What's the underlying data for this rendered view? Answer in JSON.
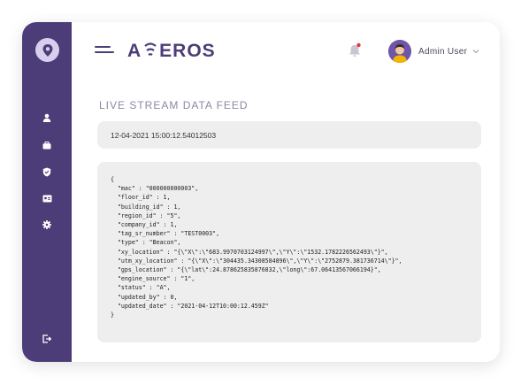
{
  "colors": {
    "sidebar": "#4c3d78",
    "accent": "#4c3d78",
    "panel": "#eeeeee",
    "notification_dot": "#e53935"
  },
  "sidebar": {
    "logo_icon": "location-pin-icon",
    "items": [
      {
        "name": "user",
        "icon": "user-icon"
      },
      {
        "name": "briefcase",
        "icon": "briefcase-icon"
      },
      {
        "name": "shield",
        "icon": "shield-icon"
      },
      {
        "name": "id-card",
        "icon": "id-card-icon"
      },
      {
        "name": "settings",
        "icon": "gear-icon"
      }
    ],
    "logout_icon": "logout-icon"
  },
  "header": {
    "brand": {
      "a": "A",
      "rest": "EROS"
    },
    "notification_icon": "bell-icon",
    "user": {
      "name": "Admin User",
      "avatar": "avatar-icon"
    }
  },
  "main": {
    "title": "LIVE STREAM DATA FEED",
    "timestamp": "12-04-2021  15:00:12.54012503",
    "json_lines": [
      "{",
      "  \"mac\" : \"000000000003\",",
      "  \"floor_id\" : 1,",
      "  \"building_id\" : 1,",
      "  \"region_id\" : \"5\",",
      "  \"company_id\" : 1,",
      "  \"tag_sr_number\" : \"TEST0003\",",
      "  \"type\" : \"Beacon\",",
      "  \"xy_location\" : \"{\\\"X\\\":\\\"683.9970703124997\\\",\\\"Y\\\":\\\"1532.1782226562493\\\"}\",",
      "  \"utm_xy_location\" : \"{\\\"X\\\":\\\"304435.34308584896\\\",\\\"Y\\\":\\\"2752879.381736714\\\"}\",",
      "  \"gps_location\" : \"{\\\"lat\\\":24.878625835876832,\\\"long\\\":67.06413567066194}\",",
      "  \"engine_source\" : \"1\",",
      "  \"status\" : \"A\",",
      "  \"updated_by\" : 0,",
      "  \"updated_date\" : \"2021-04-12T10:00:12.459Z\"",
      "}"
    ]
  }
}
